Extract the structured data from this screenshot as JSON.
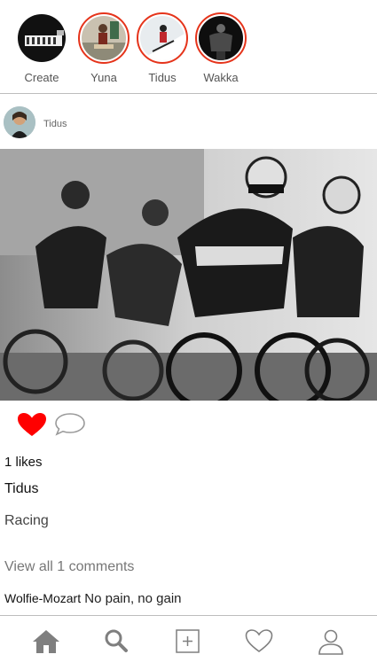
{
  "stories": [
    {
      "label": "Create",
      "icon": "keyboard-thumbnail",
      "ring": false
    },
    {
      "label": "Yuna",
      "icon": "yuna-thumbnail",
      "ring": true
    },
    {
      "label": "Tidus",
      "icon": "tidus-thumbnail",
      "ring": true
    },
    {
      "label": "Wakka",
      "icon": "wakka-thumbnail",
      "ring": true
    }
  ],
  "post": {
    "username": "Tidus",
    "image": "cyclists-racing-photo",
    "liked": true,
    "likes_text": "1 likes",
    "author": "Tidus",
    "caption": "Racing",
    "view_comments": "View all 1 comments",
    "comment": {
      "user": "Wolfie-Mozart",
      "text": "No pain, no gain"
    }
  },
  "nav": [
    {
      "name": "home-icon"
    },
    {
      "name": "search-icon"
    },
    {
      "name": "add-post-icon"
    },
    {
      "name": "heart-outline-icon"
    },
    {
      "name": "profile-icon"
    }
  ],
  "colors": {
    "accent": "#e5341b",
    "like": "#ff0000",
    "icon_gray": "#7f7f7f",
    "divider": "#bdbdbd"
  }
}
